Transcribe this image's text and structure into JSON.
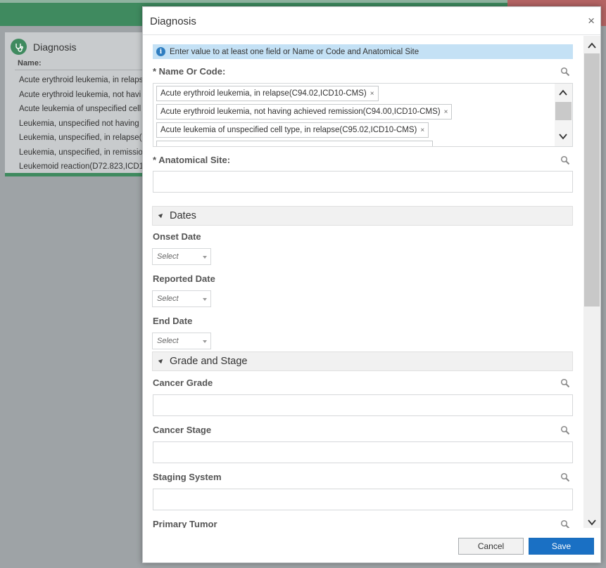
{
  "background": {
    "card": {
      "title": "Diagnosis",
      "name_label": "Name:",
      "items": [
        "Acute erythroid leukemia, in relapse",
        "Acute erythroid leukemia, not havi",
        "Acute leukemia of unspecified cell",
        "Leukemia, unspecified not having",
        "Leukemia, unspecified, in relapse(I",
        "Leukemia, unspecified, in remissio",
        "Leukemoid reaction(D72.823,ICD1"
      ]
    }
  },
  "dialog": {
    "title": "Diagnosis",
    "close_glyph": "×",
    "info_icon_glyph": "i",
    "info_text": "Enter value to at least one field or Name or Code and Anatomical Site",
    "name_or_code": {
      "label": "* Name Or Code:",
      "tags": [
        "Acute erythroid leukemia, in relapse(C94.02,ICD10-CMS)",
        "Acute erythroid leukemia, not having achieved remission(C94.00,ICD10-CMS)",
        "Acute leukemia of unspecified cell type, in relapse(C95.02,ICD10-CMS)"
      ],
      "tag_remove_glyph": "×"
    },
    "anatomical_site": {
      "label": "* Anatomical Site:",
      "value": ""
    },
    "dates_section": {
      "title": "Dates",
      "onset_label": "Onset Date",
      "onset_value": "Select",
      "reported_label": "Reported Date",
      "reported_value": "Select",
      "end_label": "End Date",
      "end_value": "Select"
    },
    "grade_section": {
      "title": "Grade and Stage",
      "cancer_grade_label": "Cancer Grade",
      "cancer_stage_label": "Cancer Stage",
      "staging_system_label": "Staging System",
      "primary_tumor_label": "Primary Tumor"
    },
    "footer": {
      "cancel_label": "Cancel",
      "save_label": "Save"
    }
  },
  "colors": {
    "accent_green": "#3f8a5f",
    "primary_blue": "#1a70c4",
    "info_bg": "#c4e1f5"
  },
  "icons": [
    "stethoscope-icon",
    "info-icon",
    "search-icon",
    "close-icon",
    "chevron-up-icon",
    "chevron-down-icon",
    "triangle-expanded-icon",
    "caret-down-icon"
  ]
}
